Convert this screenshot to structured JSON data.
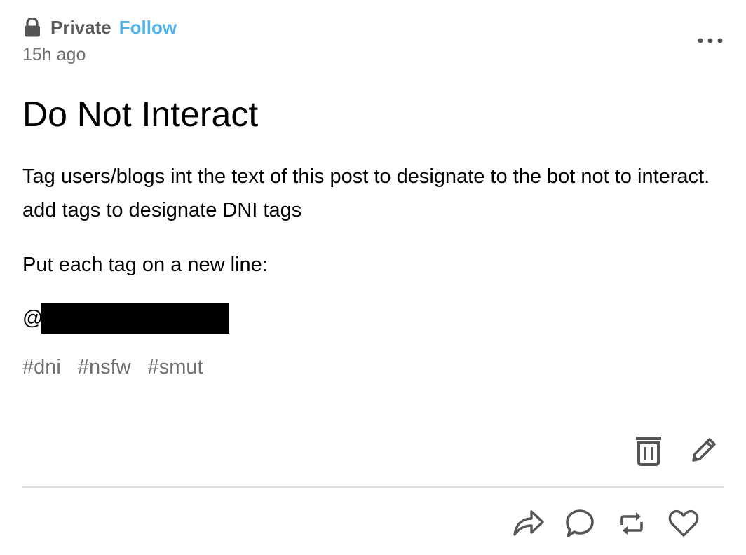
{
  "header": {
    "blog_name": "Private",
    "follow_label": "Follow",
    "timestamp": "15h ago",
    "icons": {
      "lock": "lock-icon",
      "more": "more-options-icon"
    }
  },
  "post": {
    "title": "Do Not Interact",
    "paragraphs": [
      "Tag users/blogs int the text of this post to designate to the bot not to interact. add tags to designate DNI tags",
      "Put each tag on a new line:"
    ],
    "mention_prefix": "@"
  },
  "tags": [
    "#dni",
    "#nsfw",
    "#smut"
  ],
  "edit_actions": {
    "icons": [
      "trash-icon",
      "pencil-icon"
    ]
  },
  "footer_actions": {
    "icons": [
      "share-icon",
      "comment-icon",
      "reblog-icon",
      "heart-icon"
    ]
  },
  "colors": {
    "follow": "#4fb3ee",
    "muted_text": "#6f6f6f",
    "icon_gray": "#555555",
    "divider": "#dedede",
    "redaction": "#000000"
  }
}
